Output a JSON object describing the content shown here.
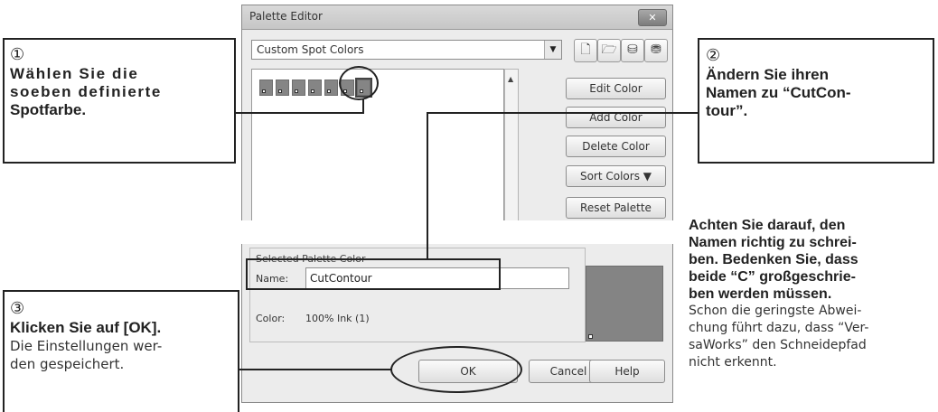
{
  "dialog": {
    "title": "Palette Editor",
    "close_glyph": "✕",
    "palette_select": "Custom Spot Colors",
    "buttons": {
      "edit_color": "Edit Color",
      "add_color": "Add Color",
      "delete_color": "Delete Color",
      "sort_colors": "Sort Colors ▼",
      "reset_palette": "Reset Palette"
    },
    "selected_group": {
      "title": "Selected Palette Color",
      "name_label": "Name:",
      "name_value": "CutContour",
      "color_label": "Color:",
      "color_value": "100%  Ink (1)"
    },
    "footer": {
      "ok": "OK",
      "cancel": "Cancel",
      "help": "Help"
    },
    "icons": [
      "new-palette-icon",
      "open-palette-icon",
      "save-palette-icon",
      "save-as-palette-icon"
    ],
    "swatch_color": "#858585"
  },
  "callouts": {
    "c1": {
      "number": "①",
      "lines": [
        "Wählen Sie die",
        "soeben definierte",
        "Spotfarbe."
      ]
    },
    "c2": {
      "number": "②",
      "lines": [
        "Ändern Sie ihren",
        "Namen zu “CutCon-",
        "tour”."
      ]
    },
    "c3": {
      "number": "③",
      "title": "Klicken Sie auf [OK].",
      "lines": [
        "Die Einstellungen wer-",
        "den gespeichert."
      ]
    },
    "note": {
      "bold_lines": [
        "Achten Sie darauf, den",
        "Namen richtig zu schrei-",
        "ben. Bedenken Sie, dass",
        "beide “C” großgeschrie-",
        "ben werden müssen."
      ],
      "normal_lines": [
        "Schon die geringste Abwei-",
        "chung führt dazu, dass “Ver-",
        "saWorks” den Schneidepfad",
        "nicht erkennt."
      ]
    }
  }
}
